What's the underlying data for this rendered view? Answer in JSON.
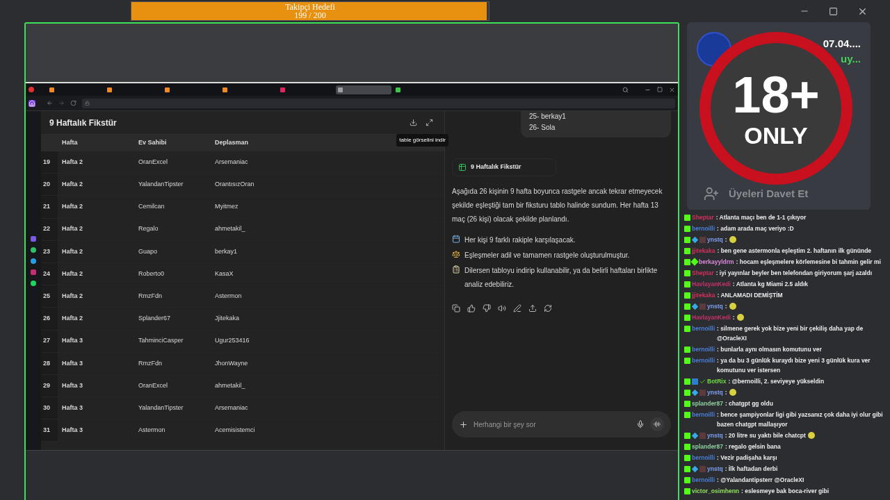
{
  "follower_goal": {
    "title": "Takipçi Hedefi",
    "count": "199 / 200",
    "level": 0.995
  },
  "browser": {
    "tabs": [
      {
        "color": "#f08a24",
        "selected": false
      },
      {
        "color": "#f08a24",
        "selected": false
      },
      {
        "color": "#f08a24",
        "selected": false
      },
      {
        "color": "#f08a24",
        "selected": false
      },
      {
        "color": "#e0245e",
        "selected": false
      },
      {
        "color": "#9aa0a6",
        "selected": true
      },
      {
        "color": "#3ec84a",
        "selected": false
      }
    ]
  },
  "table_panel": {
    "title": "9 Haftalık Fikstür",
    "tooltip": "table görselini indir",
    "columns": [
      "Hafta",
      "Ev Sahibi",
      "Deplasman"
    ],
    "rows": [
      {
        "n": "19",
        "week": "Hafta 2",
        "home": "OranExcel",
        "away": "Arsemaniac"
      },
      {
        "n": "20",
        "week": "Hafta 2",
        "home": "YalandanTipster",
        "away": "OrantısızOran"
      },
      {
        "n": "21",
        "week": "Hafta 2",
        "home": "Cemilcan",
        "away": "Myitmez"
      },
      {
        "n": "22",
        "week": "Hafta 2",
        "home": "Regalo",
        "away": "ahmetakil_"
      },
      {
        "n": "23",
        "week": "Hafta 2",
        "home": "Guapo",
        "away": "berkay1"
      },
      {
        "n": "24",
        "week": "Hafta 2",
        "home": "Roberto0",
        "away": "KasaX"
      },
      {
        "n": "25",
        "week": "Hafta 2",
        "home": "RmzFdn",
        "away": "Astermon"
      },
      {
        "n": "26",
        "week": "Hafta 2",
        "home": "Splander67",
        "away": "Jjitekaka"
      },
      {
        "n": "27",
        "week": "Hafta 3",
        "home": "TahminciCasper",
        "away": "Ugur253416"
      },
      {
        "n": "28",
        "week": "Hafta 3",
        "home": "RmzFdn",
        "away": "JhonWayne"
      },
      {
        "n": "29",
        "week": "Hafta 3",
        "home": "OranExcel",
        "away": "ahmetakil_"
      },
      {
        "n": "30",
        "week": "Hafta 3",
        "home": "YalandanTipster",
        "away": "Arsemaniac"
      },
      {
        "n": "31",
        "week": "Hafta 3",
        "home": "Astermon",
        "away": "Acemisistemci"
      }
    ]
  },
  "assistant_panel": {
    "user_bubble": [
      "25- berkay1",
      "26- Sola"
    ],
    "artifact": "9 Haftalık Fikstür",
    "paragraph": "Aşağıda 26 kişinin 9 hafta boyunca rastgele ancak tekrar etmeyecek şekilde eşleştiği tam bir fiksturu tablo halinde sundum. Her hafta 13 maç (26 kişi) olacak şekilde planlandı.",
    "bullets": [
      {
        "kind": "calendar",
        "text": "Her kişi 9 farklı rakiple karşılaşacak."
      },
      {
        "kind": "scales",
        "text": "Eşleşmeler adil ve tamamen rastgele oluşturulmuştur."
      },
      {
        "kind": "clipboard",
        "text": "Dilersen tabloyu indirip kullanabilir, ya da belirli haftaları birlikte analiz edebiliriz."
      }
    ],
    "input_placeholder": "Herhangi bir şey sor"
  },
  "channel_card": {
    "date": "07.04....",
    "status": "uy...",
    "invite": "Üyeleri Davet Et",
    "age_badge": {
      "number": "18+",
      "word": "ONLY"
    }
  },
  "chat": [
    {
      "name": "Sheptar",
      "color": "#d0305a",
      "badges": [
        {
          "kind": "kick"
        }
      ],
      "text": ": Atlanta maçı ben de 1-1 çıkıyor",
      "emote": false
    },
    {
      "name": "bernoilli",
      "color": "#4a7fd6",
      "badges": [
        {
          "kind": "kick"
        }
      ],
      "text": ": adam arada maç veriyo :D",
      "emote": false
    },
    {
      "name": "ynstq",
      "color": "#7f9ff0",
      "badges": [
        {
          "kind": "kick"
        },
        {
          "kind": "cube"
        },
        {
          "kind": "cross"
        }
      ],
      "text": ":",
      "emote": true
    },
    {
      "name": "jjitekaka",
      "color": "#d0305a",
      "badges": [
        {
          "kind": "kick"
        }
      ],
      "text": ": ben gene astermonla eşleştim 2. haftanın ilk gününde",
      "emote": false
    },
    {
      "name": "berkayyldrm",
      "color": "#d88ad8",
      "badges": [
        {
          "kind": "kick"
        },
        {
          "kind": "gem"
        }
      ],
      "text": ": hocam eşleşmelere körlemesine bi tahmin gelir mi",
      "emote": false
    },
    {
      "name": "Sheptar",
      "color": "#d0305a",
      "badges": [
        {
          "kind": "kick"
        }
      ],
      "text": ": iyi yayınlar beyler ben telefondan giriyorum şarj azaldı",
      "emote": false
    },
    {
      "name": "HavlayanKedi",
      "color": "#c8306a",
      "badges": [
        {
          "kind": "kick"
        }
      ],
      "text": ": Atlanta kg Miami 2.5 aldık",
      "emote": false
    },
    {
      "name": "jjitekaka",
      "color": "#d0305a",
      "badges": [
        {
          "kind": "kick"
        }
      ],
      "text": ": ANLAMADI DEMİŞTİM",
      "emote": false
    },
    {
      "name": "ynstq",
      "color": "#7f9ff0",
      "badges": [
        {
          "kind": "kick"
        },
        {
          "kind": "cube"
        },
        {
          "kind": "cross"
        }
      ],
      "text": ":",
      "emote": true
    },
    {
      "name": "HavlayanKedi",
      "color": "#c8306a",
      "badges": [
        {
          "kind": "kick"
        }
      ],
      "text": ":",
      "emote": true
    },
    {
      "name": "bernoilli",
      "color": "#4a7fd6",
      "badges": [
        {
          "kind": "kick"
        }
      ],
      "text": ": silmene gerek yok bize yeni bir çekiliş daha yap de @OracleXI",
      "emote": false
    },
    {
      "name": "bernoilli",
      "color": "#4a7fd6",
      "badges": [
        {
          "kind": "kick"
        }
      ],
      "text": ": bunlarla aynı olmasın komutunu ver",
      "emote": false
    },
    {
      "name": "bernoilli",
      "color": "#4a7fd6",
      "badges": [
        {
          "kind": "kick"
        }
      ],
      "text": ": ya da bu 3 günlük kuraydı bize yeni 3 günlük kura ver komutunu ver istersen",
      "emote": false
    },
    {
      "name": "BotRix",
      "color": "#6fdc3a",
      "badges": [
        {
          "kind": "kick"
        },
        {
          "kind": "bot"
        },
        {
          "kind": "verified"
        }
      ],
      "text": ": @bernoilli, 2. seviyeye yükseldin",
      "emote": false
    },
    {
      "name": "ynstq",
      "color": "#7f9ff0",
      "badges": [
        {
          "kind": "kick"
        },
        {
          "kind": "cube"
        },
        {
          "kind": "cross"
        }
      ],
      "text": ":",
      "emote": true
    },
    {
      "name": "splander87",
      "color": "#8fd0a0",
      "badges": [
        {
          "kind": "kick"
        }
      ],
      "text": ": chatgpt gg oldu",
      "emote": false
    },
    {
      "name": "bernoilli",
      "color": "#4a7fd6",
      "badges": [
        {
          "kind": "kick"
        }
      ],
      "text": ": bence şampiyonlar ligi gibi yazsanız çok daha iyi olur gibi bazen chatgpt mallaşıyor",
      "emote": false
    },
    {
      "name": "ynstq",
      "color": "#7f9ff0",
      "badges": [
        {
          "kind": "kick"
        },
        {
          "kind": "cube"
        },
        {
          "kind": "cross"
        }
      ],
      "text": ": 20 litre su yaktı bile chatcpt",
      "emote": true
    },
    {
      "name": "splander87",
      "color": "#8fd0a0",
      "badges": [
        {
          "kind": "kick"
        }
      ],
      "text": ": regalo gelsin bana",
      "emote": false
    },
    {
      "name": "bernoilli",
      "color": "#4a7fd6",
      "badges": [
        {
          "kind": "kick"
        }
      ],
      "text": ": Vezir padişaha karşı",
      "emote": false
    },
    {
      "name": "ynstq",
      "color": "#7f9ff0",
      "badges": [
        {
          "kind": "kick"
        },
        {
          "kind": "cube"
        },
        {
          "kind": "cross"
        }
      ],
      "text": ": İlk haftadan derbi",
      "emote": false
    },
    {
      "name": "bernoilli",
      "color": "#4a7fd6",
      "badges": [
        {
          "kind": "kick"
        }
      ],
      "text": ": @Yalandantipsterr @OracleXI",
      "emote": false
    },
    {
      "name": "victor_osimhenn",
      "color": "#8fe05a",
      "badges": [
        {
          "kind": "kick"
        }
      ],
      "text": ": eslesmeye bak boca-river gibi",
      "emote": false
    }
  ]
}
